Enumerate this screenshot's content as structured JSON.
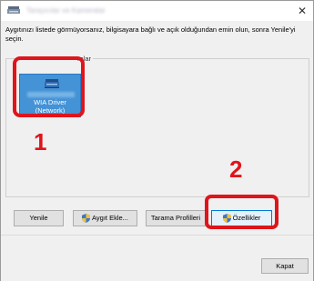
{
  "window": {
    "title": "Tarayıcılar ve Kameralar",
    "close_glyph": "✕"
  },
  "instructions": "Aygıtınızı listede görmüyorsanız, bilgisayara bağlı ve açık olduğundan emin olun, sonra Yenile'yi seçin.",
  "device_group": {
    "label_visible": "ralar",
    "devices": [
      {
        "name_line1": "WIA Driver",
        "name_line2": "(Network)",
        "icon": "scanner-icon",
        "selected": true
      }
    ]
  },
  "callouts": {
    "step1": "1",
    "step2": "2",
    "color": "#e0141b"
  },
  "buttons": {
    "refresh": "Yenile",
    "add_device": "Aygıt Ekle...",
    "scan_profiles": "Tarama Profilleri",
    "properties": "Özellikler",
    "close": "Kapat"
  },
  "colors": {
    "selection": "#4393d6",
    "window_bg": "#f0f0f0",
    "accent": "#0078d7"
  }
}
